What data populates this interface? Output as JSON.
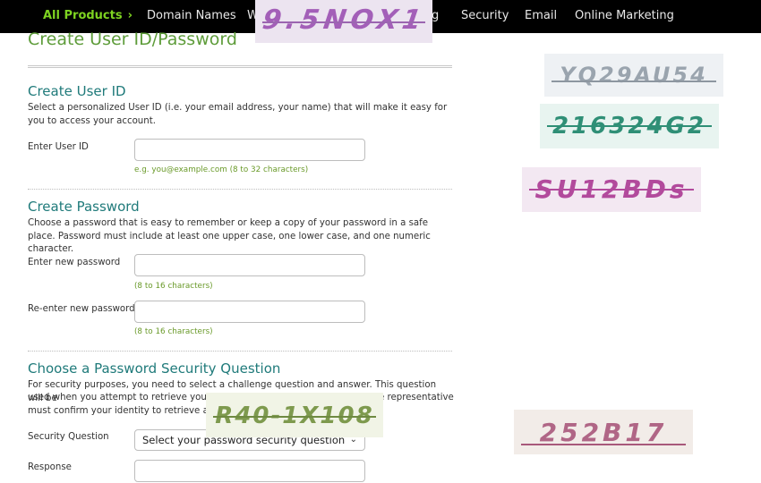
{
  "nav": {
    "all_products": "All Products",
    "items": [
      {
        "label": "Domain Names"
      },
      {
        "label": "W"
      },
      {
        "label": "g"
      },
      {
        "label": "Security"
      },
      {
        "label": "Email"
      },
      {
        "label": "Online Marketing"
      }
    ]
  },
  "page": {
    "title": "Create User ID/Password"
  },
  "user_id": {
    "title": "Create User ID",
    "description": "Select a personalized User ID (i.e. your email address, your name) that will make it easy for you to access your account.",
    "label": "Enter User ID",
    "value": "",
    "hint": "e.g. you@example.com (8 to 32 characters)"
  },
  "password": {
    "title": "Create Password",
    "description": "Choose a password that is easy to remember or keep a copy of your password in a safe place. Password must include at least one upper case, one lower case, and one numeric character.",
    "new_label": "Enter new password",
    "new_hint": "(8 to 16 characters)",
    "reenter_label": "Re-enter new password",
    "reenter_hint": "(8 to 16 characters)"
  },
  "security_question": {
    "title": "Choose a Password Security Question",
    "description_line1": "For security purposes, you need to select a challenge question and answer. This question will be",
    "description_line2a": "used when you attempt to retrieve your pa",
    "description_line2b": "e representative",
    "description_line3": "must confirm your identity to retrieve a fo",
    "question_label": "Security Question",
    "select_value": "Select your password security question",
    "response_label": "Response"
  },
  "captchas": [
    {
      "text": "9.5NOX1"
    },
    {
      "text": "YQ29AU54"
    },
    {
      "text": "216324G2"
    },
    {
      "text": "SU12BDs"
    },
    {
      "text": "R40-1X108"
    },
    {
      "text": "252B17"
    }
  ],
  "colors": {
    "nav_bg": "#000000",
    "nav_accent": "#7ed321",
    "title_green": "#5e9c3a",
    "section_teal": "#1f7a7a",
    "hint_green": "#6a9a2a"
  }
}
